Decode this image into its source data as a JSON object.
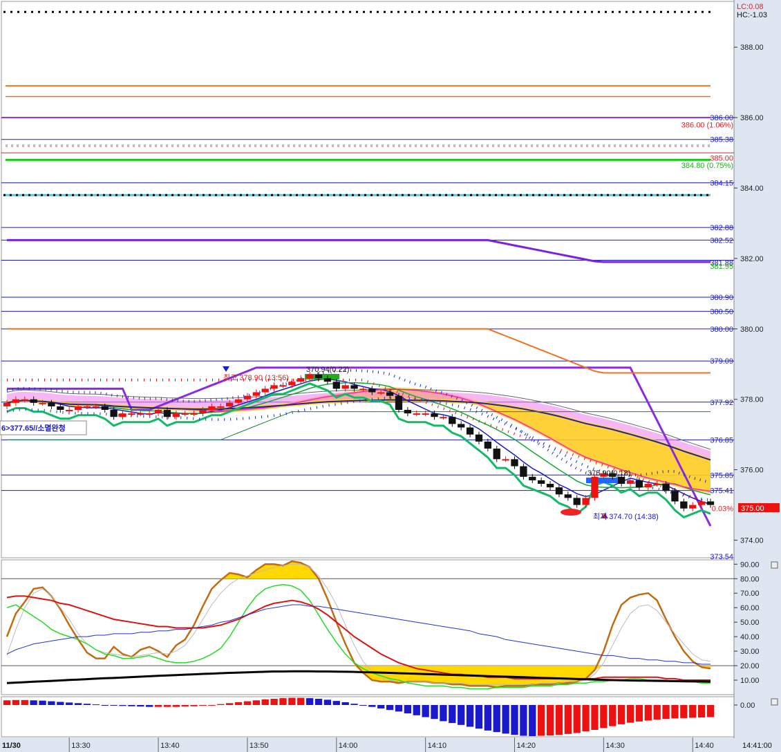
{
  "header": {
    "lc": "LC:0.08",
    "hc": "HC:-1.03"
  },
  "colors": {
    "up": "#ee1111",
    "down": "#111111",
    "blue": "#1a1acc",
    "orange": "#f07020",
    "purple": "#8a2be2",
    "green": "#22cc22",
    "yellow": "#ffd800",
    "axisBg": "#dde6f1"
  },
  "price_axis": {
    "ticks": [
      "388.00",
      "386.00",
      "384.00",
      "382.00",
      "380.00",
      "378.00",
      "376.00",
      "374.00"
    ]
  },
  "osc_axis": {
    "ticks": [
      "90.00",
      "80.00",
      "70.00",
      "60.00",
      "50.00",
      "40.00",
      "30.00",
      "20.00",
      "10.00"
    ]
  },
  "macd_axis": {
    "ticks": [
      "0.00"
    ]
  },
  "time_axis": {
    "date": "11/30",
    "labels": [
      "13:30",
      "13:40",
      "13:50",
      "14:00",
      "14:10",
      "14:20",
      "14:30",
      "14:40"
    ],
    "end": "14:41:00"
  },
  "level_labels": [
    {
      "text": "386.00",
      "color": "#1a1acc"
    },
    {
      "text": "386.00 (1.06%)",
      "color": "#dd2222"
    },
    {
      "text": "385.38",
      "color": "#1a1acc"
    },
    {
      "text": "385.00",
      "color": "#dd2222"
    },
    {
      "text": "384.80 (0.75%)",
      "color": "#22aa22"
    },
    {
      "text": "384.15",
      "color": "#1a1acc"
    },
    {
      "text": "382.88",
      "color": "#1a1acc"
    },
    {
      "text": "382.52",
      "color": "#1a1acc"
    },
    {
      "text": "381.88",
      "color": "#1a1acc"
    },
    {
      "text": "381.95",
      "color": "#22aa22"
    },
    {
      "text": "380.90",
      "color": "#1a1acc"
    },
    {
      "text": "380.50",
      "color": "#1a1acc"
    },
    {
      "text": "380.00",
      "color": "#1a1acc"
    },
    {
      "text": "379.09",
      "color": "#1a1acc"
    },
    {
      "text": "377.92",
      "color": "#1a1acc"
    },
    {
      "text": "376.85",
      "color": "#1a1acc"
    },
    {
      "text": "375.85",
      "color": "#1a1acc"
    },
    {
      "text": "375.41",
      "color": "#1a1acc"
    },
    {
      "text": "0.03%",
      "color": "#dd2222"
    },
    {
      "text": "373.54",
      "color": "#1a1acc"
    }
  ],
  "current_price": "375.00",
  "annotations": {
    "high": "최고 378.90 (13:56)",
    "low": "최저 374.70 (14:38)",
    "box1": "370.94(0.22)",
    "box2": "375.90(0.18)",
    "left_note": "6>377.65//소멸완청"
  },
  "chart_data": [
    {
      "type": "candlestick",
      "ylim": [
        373.5,
        389.3
      ],
      "x": [
        "13:23",
        "13:24",
        "13:25",
        "13:26",
        "13:27",
        "13:28",
        "13:29",
        "13:30",
        "13:31",
        "13:32",
        "13:33",
        "13:34",
        "13:35",
        "13:36",
        "13:37",
        "13:38",
        "13:39",
        "13:40",
        "13:41",
        "13:42",
        "13:43",
        "13:44",
        "13:45",
        "13:46",
        "13:47",
        "13:48",
        "13:49",
        "13:50",
        "13:51",
        "13:52",
        "13:53",
        "13:54",
        "13:55",
        "13:56",
        "13:57",
        "13:58",
        "13:59",
        "14:00",
        "14:01",
        "14:02",
        "14:03",
        "14:04",
        "14:05",
        "14:06",
        "14:07",
        "14:08",
        "14:09",
        "14:10",
        "14:11",
        "14:12",
        "14:13",
        "14:14",
        "14:15",
        "14:16",
        "14:17",
        "14:18",
        "14:19",
        "14:20",
        "14:21",
        "14:22",
        "14:23",
        "14:24",
        "14:25",
        "14:26",
        "14:27",
        "14:28",
        "14:29",
        "14:30",
        "14:31",
        "14:32",
        "14:33",
        "14:34",
        "14:35",
        "14:36",
        "14:37",
        "14:38",
        "14:39",
        "14:40"
      ],
      "close": [
        377.9,
        378.0,
        378.0,
        377.9,
        377.9,
        377.8,
        377.7,
        377.7,
        377.8,
        377.8,
        377.8,
        377.7,
        377.5,
        377.6,
        377.6,
        377.6,
        377.6,
        377.7,
        377.5,
        377.6,
        377.6,
        377.6,
        377.7,
        377.8,
        377.8,
        377.9,
        378.0,
        378.1,
        378.2,
        378.3,
        378.4,
        378.4,
        378.5,
        378.6,
        378.7,
        378.6,
        378.5,
        378.3,
        378.4,
        378.3,
        378.3,
        378.2,
        378.2,
        378.1,
        377.7,
        377.6,
        377.6,
        377.6,
        377.5,
        377.5,
        377.3,
        377.2,
        377.0,
        376.8,
        376.6,
        376.3,
        376.3,
        376.1,
        375.8,
        375.7,
        375.6,
        375.5,
        375.3,
        375.2,
        375.0,
        375.2,
        375.8,
        375.9,
        375.8,
        375.6,
        375.7,
        375.5,
        375.6,
        375.6,
        375.4,
        375.1,
        374.9,
        375.0,
        375.1,
        375.0
      ],
      "series": [
        {
          "name": "",
          "values": [
            377.8,
            377.8,
            377.9,
            377.9,
            377.8,
            377.8,
            377.7,
            377.7,
            377.7,
            377.8,
            377.8,
            377.7,
            377.6,
            377.6,
            377.6,
            377.6,
            377.6,
            377.7,
            377.6,
            377.6,
            377.6,
            377.6,
            377.7,
            377.8,
            377.8,
            377.9,
            378.0,
            378.1,
            378.2,
            378.2,
            378.3,
            378.4,
            378.5,
            378.5,
            378.6,
            378.6,
            378.5,
            378.4,
            378.4,
            378.3,
            378.3,
            378.3,
            378.2,
            378.1,
            377.9,
            377.7,
            377.6,
            377.6,
            377.5,
            377.4,
            377.3,
            377.2,
            377.0,
            376.8,
            376.6,
            376.4,
            376.2,
            376.1,
            375.9,
            375.7,
            375.6,
            375.5,
            375.4,
            375.2,
            375.1,
            375.2,
            375.4,
            375.6,
            375.7,
            375.6,
            375.6,
            375.6,
            375.5,
            375.5,
            375.4,
            375.2,
            375.0,
            375.0,
            375.0,
            375.0
          ]
        }
      ]
    },
    {
      "type": "line",
      "ylim": [
        0,
        93
      ],
      "series": [
        {
          "name": "",
          "values": [
            40,
            56,
            64,
            73,
            74,
            68,
            59,
            48,
            38,
            29,
            25,
            25,
            33,
            28,
            26,
            31,
            33,
            30,
            26,
            34,
            38,
            48,
            61,
            73,
            79,
            84,
            83,
            81,
            86,
            90,
            90,
            89,
            92,
            91,
            88,
            80,
            66,
            50,
            35,
            22,
            15,
            10,
            9,
            9,
            8,
            9,
            9,
            9,
            8,
            8,
            7,
            7,
            6,
            6,
            6,
            5,
            6,
            6,
            6,
            7,
            7,
            7,
            8,
            8,
            9,
            11,
            17,
            30,
            48,
            62,
            67,
            69,
            70,
            65,
            52,
            40,
            30,
            23,
            19,
            18
          ]
        },
        {
          "name": "",
          "values": [
            27,
            45,
            60,
            70,
            73,
            68,
            60,
            52,
            42,
            35,
            31,
            29,
            28,
            27,
            26,
            27,
            28,
            29,
            28,
            30,
            34,
            42,
            52,
            62,
            70,
            76,
            80,
            82,
            84,
            86,
            88,
            89,
            90,
            90,
            88,
            82,
            73,
            62,
            48,
            34,
            23,
            16,
            12,
            10,
            9,
            9,
            9,
            9,
            8,
            8,
            8,
            8,
            7,
            7,
            7,
            7,
            7,
            7,
            7,
            7,
            8,
            8,
            8,
            9,
            9,
            10,
            14,
            22,
            34,
            46,
            56,
            61,
            62,
            58,
            50,
            42,
            35,
            28,
            24,
            23
          ]
        },
        {
          "name": "",
          "values": [
            60,
            62,
            58,
            54,
            50,
            45,
            42,
            40,
            38,
            35,
            31,
            28,
            27,
            25,
            25,
            26,
            27,
            25,
            23,
            22,
            22,
            23,
            25,
            28,
            32,
            40,
            50,
            60,
            68,
            73,
            75,
            76,
            75,
            72,
            65,
            55,
            45,
            36,
            28,
            22,
            18,
            15,
            13,
            11,
            10,
            8,
            7,
            6,
            6,
            6,
            5,
            5,
            4,
            4,
            4,
            5,
            5,
            5,
            5,
            6,
            6,
            6,
            7,
            7,
            8,
            8,
            9,
            9,
            10,
            10,
            11,
            11,
            10,
            10,
            10,
            9,
            9,
            9,
            8,
            8
          ]
        },
        {
          "name": "",
          "values": [
            67,
            68,
            68,
            67,
            66,
            65,
            63,
            62,
            60,
            58,
            56,
            54,
            52,
            51,
            50,
            49,
            48,
            47,
            47,
            46,
            46,
            46,
            46,
            47,
            48,
            50,
            52,
            55,
            58,
            61,
            63,
            64,
            65,
            64,
            62,
            59,
            55,
            50,
            45,
            40,
            36,
            32,
            28,
            25,
            22,
            20,
            18,
            17,
            16,
            15,
            14,
            14,
            13,
            13,
            12,
            12,
            12,
            11,
            11,
            11,
            11,
            11,
            11,
            11,
            11,
            11,
            11,
            12,
            12,
            12,
            12,
            12,
            12,
            12,
            11,
            11,
            10,
            10,
            10,
            10
          ]
        },
        {
          "name": "",
          "values": [
            28,
            31,
            33,
            35,
            36,
            37,
            38,
            39,
            40,
            40,
            41,
            41,
            42,
            42,
            42,
            43,
            43,
            44,
            44,
            45,
            45,
            46,
            47,
            48,
            50,
            51,
            53,
            55,
            57,
            59,
            60,
            61,
            62,
            62,
            61,
            61,
            60,
            59,
            58,
            57,
            56,
            55,
            54,
            53,
            52,
            51,
            50,
            49,
            48,
            47,
            46,
            45,
            44,
            42,
            41,
            40,
            38,
            37,
            36,
            35,
            34,
            33,
            32,
            31,
            30,
            29,
            28,
            27,
            27,
            26,
            25,
            25,
            24,
            24,
            23,
            23,
            22,
            22,
            21,
            21
          ]
        },
        {
          "name": "",
          "values": [
            8,
            8.3,
            8.6,
            8.9,
            9.2,
            9.5,
            9.8,
            10.1,
            10.4,
            10.7,
            11,
            11.3,
            11.5,
            11.8,
            12.1,
            12.4,
            12.7,
            13,
            13.2,
            13.5,
            13.8,
            14,
            14.3,
            14.5,
            14.8,
            15,
            15.2,
            15.4,
            15.6,
            15.8,
            16,
            16,
            16.1,
            16.1,
            16.1,
            16,
            16,
            15.9,
            15.8,
            15.7,
            15.5,
            15.4,
            15.2,
            15,
            14.8,
            14.6,
            14.4,
            14.2,
            14,
            13.8,
            13.6,
            13.4,
            13.2,
            13,
            12.8,
            12.6,
            12.4,
            12.2,
            12,
            11.8,
            11.6,
            11.4,
            11.2,
            11,
            10.8,
            10.6,
            10.4,
            10.2,
            10,
            9.9,
            9.8,
            9.7,
            9.6,
            9.5,
            9.4,
            9.3,
            9.2,
            9.1,
            9.1,
            9
          ]
        }
      ]
    },
    {
      "type": "bar",
      "ylim": [
        -1,
        1
      ],
      "series": [
        {
          "name": "",
          "values": [
            0.15,
            0.16,
            0.16,
            0.15,
            0.14,
            0.12,
            0.1,
            0.08,
            0.06,
            0.04,
            0.02,
            0.0,
            -0.02,
            -0.03,
            -0.04,
            -0.05,
            -0.06,
            -0.06,
            -0.06,
            -0.06,
            -0.05,
            -0.04,
            -0.02,
            0.0,
            0.03,
            0.06,
            0.09,
            0.12,
            0.15,
            0.18,
            0.2,
            0.22,
            0.23,
            0.23,
            0.22,
            0.2,
            0.17,
            0.13,
            0.09,
            0.04,
            -0.01,
            -0.06,
            -0.11,
            -0.16,
            -0.21,
            -0.27,
            -0.33,
            -0.39,
            -0.45,
            -0.52,
            -0.58,
            -0.64,
            -0.7,
            -0.76,
            -0.82,
            -0.87,
            -0.92,
            -0.96,
            -0.99,
            -1.0,
            -0.99,
            -0.98,
            -0.96,
            -0.93,
            -0.9,
            -0.85,
            -0.8,
            -0.74,
            -0.68,
            -0.62,
            -0.57,
            -0.53,
            -0.5,
            -0.47,
            -0.45,
            -0.43,
            -0.42,
            -0.41,
            -0.4,
            -0.39
          ]
        }
      ]
    }
  ]
}
